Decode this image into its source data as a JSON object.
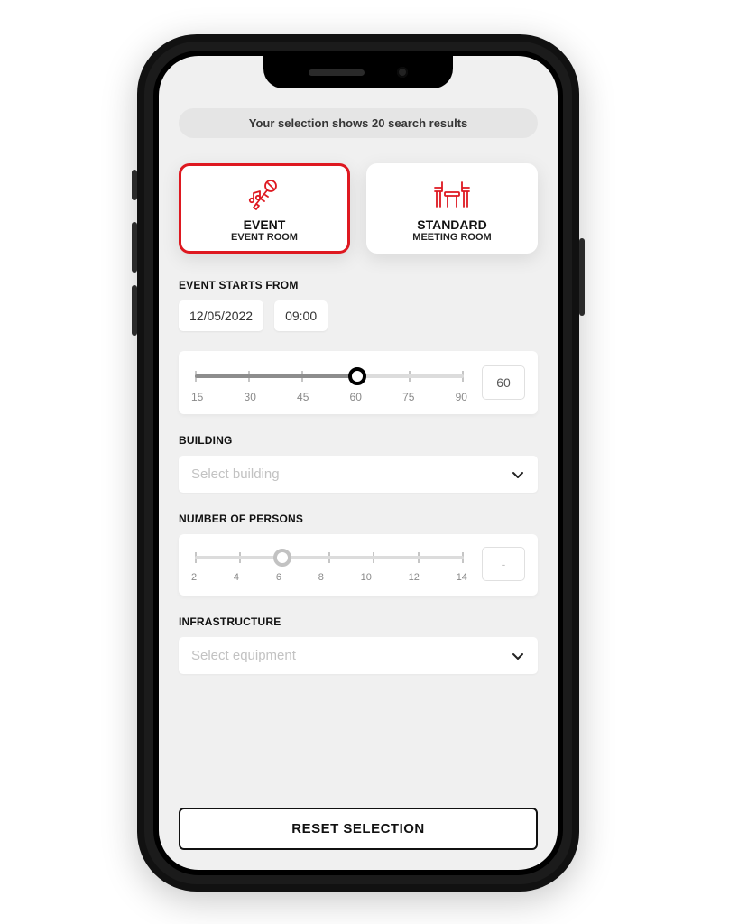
{
  "results_banner": "Your selection shows 20 search results",
  "room_types": [
    {
      "title": "EVENT",
      "subtitle": "EVENT ROOM",
      "icon": "microphone-music-icon",
      "selected": true
    },
    {
      "title": "STANDARD",
      "subtitle": "MEETING ROOM",
      "icon": "meeting-table-icon",
      "selected": false
    }
  ],
  "start": {
    "label": "EVENT STARTS FROM",
    "date": "12/05/2022",
    "time": "09:00"
  },
  "duration_slider": {
    "min": 15,
    "max": 90,
    "step": 15,
    "ticks": [
      "15",
      "30",
      "45",
      "60",
      "75",
      "90"
    ],
    "value": 60,
    "readout": "60"
  },
  "building": {
    "label": "BUILDING",
    "placeholder": "Select building"
  },
  "persons": {
    "label": "NUMBER OF PERSONS",
    "min": 2,
    "max": 14,
    "step": 2,
    "ticks": [
      "2",
      "4",
      "6",
      "8",
      "10",
      "12",
      "14"
    ],
    "value": 6,
    "readout": "-"
  },
  "infrastructure": {
    "label": "INFRASTRUCTURE",
    "placeholder": "Select equipment"
  },
  "reset_label": "RESET SELECTION",
  "colors": {
    "accent": "#de1820"
  }
}
